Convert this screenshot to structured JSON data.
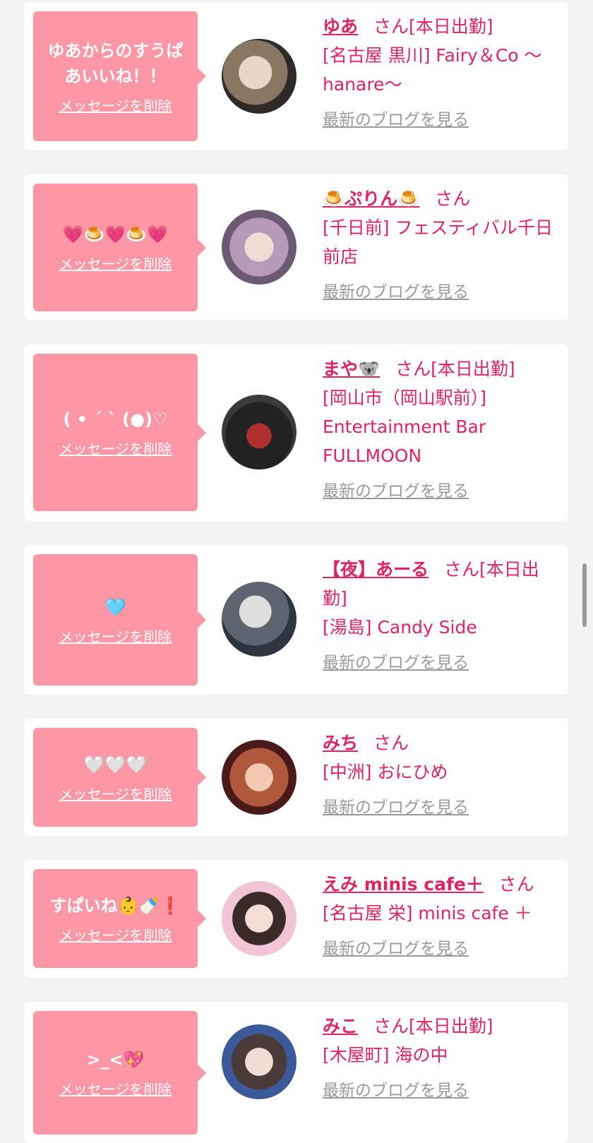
{
  "ui": {
    "delete_label": "メッセージを削除",
    "blog_label": "最新のブログを見る",
    "san": "さん"
  },
  "cards": [
    {
      "message": "ゆあからのすうぱあいいね！！",
      "name": "ゆあ",
      "status": "[本日出勤]",
      "shop": "[名古屋 黒川] Fairy＆Co 〜hanare〜"
    },
    {
      "message": "💗🍮💗🍮💗",
      "name": "🍮ぷりん🍮",
      "status": "",
      "shop": "[千日前] フェスティバル千日前店"
    },
    {
      "message": "( • ´ ` (●)♡",
      "name": "まや🐨",
      "status": "[本日出勤]",
      "shop": "[岡山市（岡山駅前）] Entertainment Bar FULLMOON"
    },
    {
      "message": "🩵",
      "name": "【夜】あーる",
      "status": "[本日出勤]",
      "shop": "[湯島] Candy Side"
    },
    {
      "message": "🤍🤍🤍",
      "name": "みち",
      "status": "",
      "shop": "[中洲] おにひめ"
    },
    {
      "message": "すぱいね👶🍼❗",
      "name": "えみ minis cafe＋",
      "status": "",
      "shop": "[名古屋 栄] minis cafe ＋"
    },
    {
      "message": ">_<💖",
      "name": "みこ",
      "status": "[本日出勤]",
      "shop": "[木屋町] 海の中"
    }
  ]
}
